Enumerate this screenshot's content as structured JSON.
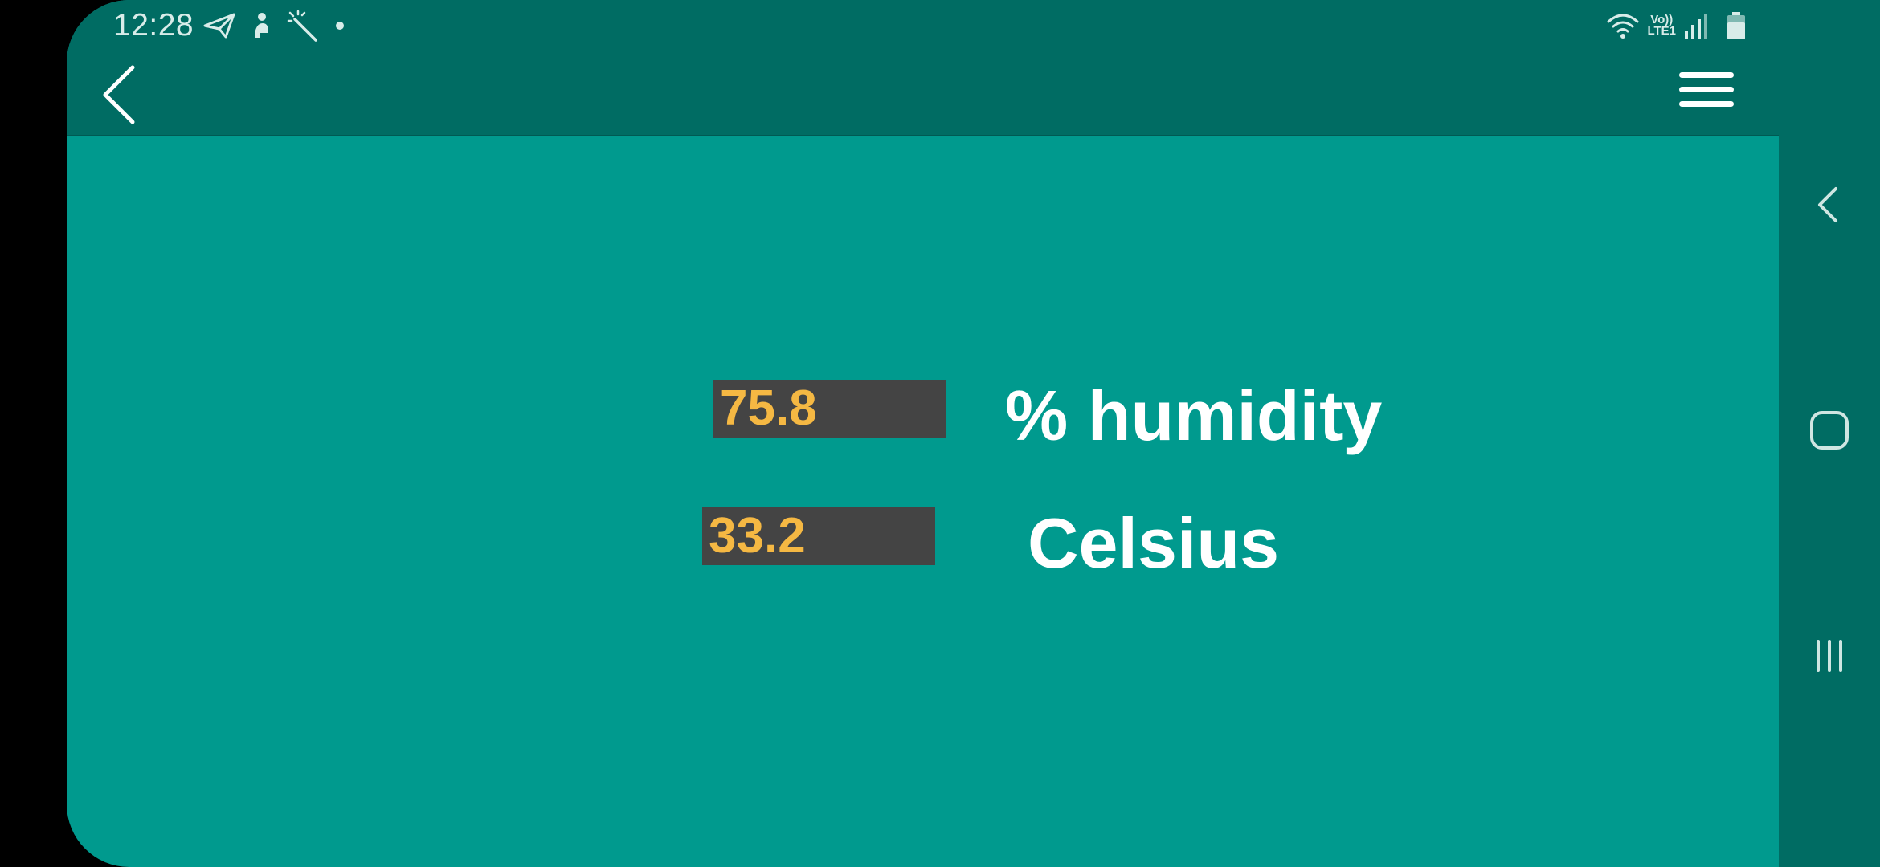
{
  "status_bar": {
    "time": "12:28",
    "lte_top": "Vo))",
    "lte_bottom": "LTE1"
  },
  "toolbar": {
    "back_icon": "chevron-left-icon",
    "menu_icon": "hamburger-menu-icon"
  },
  "readings": {
    "humidity_value": "75.8",
    "humidity_label": "% humidity",
    "temperature_value": "33.2",
    "temperature_label": "Celsius"
  },
  "colors": {
    "background": "#009a8e",
    "toolbar": "#006c63",
    "value_box": "#444444",
    "value_text": "#f5b843",
    "label_text": "#ffffff"
  },
  "nav_bar": {
    "back_icon": "nav-back-icon",
    "home_icon": "nav-home-icon",
    "recents_icon": "nav-recents-icon"
  }
}
